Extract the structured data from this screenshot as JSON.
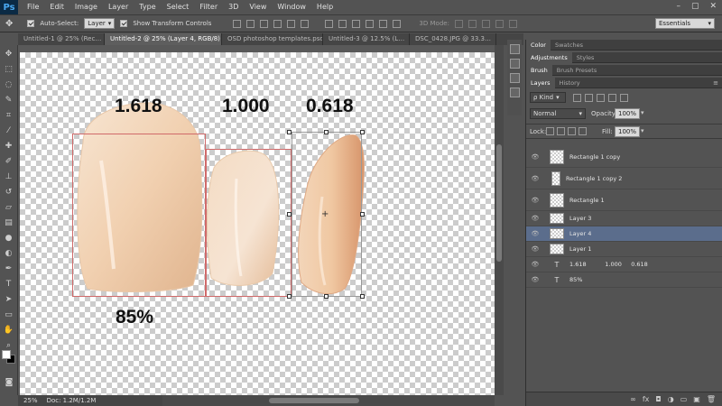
{
  "app": {
    "logo": "Ps"
  },
  "menu": [
    "File",
    "Edit",
    "Image",
    "Layer",
    "Type",
    "Select",
    "Filter",
    "3D",
    "View",
    "Window",
    "Help"
  ],
  "window_controls": [
    "–",
    "▢",
    "✕"
  ],
  "options": {
    "auto_select_label": "Auto-Select:",
    "auto_select_target": "Layer",
    "transform_label": "Show Transform Controls",
    "mode_3d_label": "3D Mode:",
    "workspace": "Essentials"
  },
  "doc_tabs": [
    {
      "label": "Untitled-1 @ 25% (Rec…",
      "active": false
    },
    {
      "label": "Untitled-2 @ 25% (Layer 4, RGB/8) *",
      "active": true
    },
    {
      "label": "OSD photoshop templates.psd",
      "active": false
    },
    {
      "label": "Untitled-3 @ 12.5% (L…",
      "active": false
    },
    {
      "label": "DSC_0428.JPG @ 33.3…",
      "active": false
    }
  ],
  "canvas": {
    "ratio_left": "1.618",
    "ratio_mid": "1.000",
    "ratio_right": "0.618",
    "percent": "85%",
    "tooth_colors": {
      "light": "#f7e7d6",
      "mid": "#efc9a3",
      "dark": "#dca47a",
      "shadow": "#c98c64"
    },
    "guide_color": "#d06a6a"
  },
  "status": {
    "zoom": "25%",
    "doc": "Doc: 1.2M/1.2M"
  },
  "panels": {
    "tabs_top": [
      "Color",
      "Swatches"
    ],
    "tabs_adj": [
      "Adjustments",
      "Styles"
    ],
    "tabs_brush": [
      "Brush",
      "Brush Presets"
    ],
    "tabs_layers": [
      "Layers",
      "History"
    ],
    "kind": "ρ Kind",
    "blend_mode": "Normal",
    "opacity_label": "Opacity:",
    "opacity_value": "100%",
    "lock_label": "Lock:",
    "fill_label": "Fill:",
    "fill_value": "100%"
  },
  "layers": [
    {
      "name": "Rectangle 1 copy",
      "type": "shape",
      "selected": false
    },
    {
      "name": "Rectangle 1 copy 2",
      "type": "shape",
      "selected": false
    },
    {
      "name": "Rectangle 1",
      "type": "shape",
      "selected": false
    },
    {
      "name": "Layer 3",
      "type": "pixel",
      "selected": false
    },
    {
      "name": "Layer 4",
      "type": "pixel",
      "selected": true
    },
    {
      "name": "Layer 1",
      "type": "pixel",
      "selected": false
    },
    {
      "name": "1.618          1.000     0.618",
      "type": "text",
      "selected": false
    },
    {
      "name": "85%",
      "type": "text",
      "selected": false
    }
  ],
  "icons": [
    "move-tool-icon",
    "marquee-tool-icon",
    "lasso-tool-icon",
    "quick-select-icon",
    "crop-tool-icon",
    "eyedropper-icon",
    "healing-brush-icon",
    "brush-tool-icon",
    "clone-stamp-icon",
    "history-brush-icon",
    "eraser-icon",
    "gradient-icon",
    "blur-icon",
    "dodge-icon",
    "pen-tool-icon",
    "type-tool-icon",
    "path-select-icon",
    "shape-tool-icon",
    "hand-tool-icon",
    "zoom-tool-icon"
  ]
}
